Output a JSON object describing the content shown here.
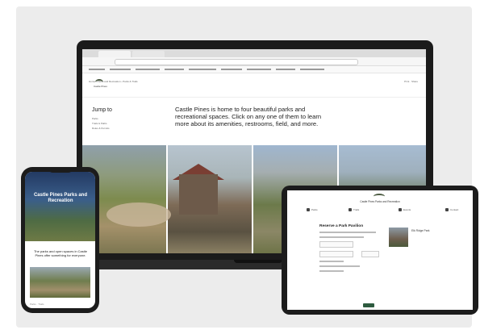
{
  "laptop": {
    "site_logo_text": "Castle Pines",
    "breadcrumb": "Home  ›  Parks and Recreation  ›  Parks & Trails",
    "share_text": "Print  ·  Share",
    "jump_to": "Jump to",
    "jump_links": [
      "Parks",
      "Trails & Paths",
      "Rules & Permits"
    ],
    "intro_text": "Castle Pines is home to four beautiful parks and recreational spaces. Click on any one of them to learn more about its amenities, restrooms, field, and more."
  },
  "phone": {
    "hero_title": "Castle Pines Parks and Recreation",
    "body_text": "The parks and open spaces in Castle Pines offer something for everyone.",
    "footer_text": "Parks  ·  Trails"
  },
  "tablet": {
    "site_title": "Castle Pines Parks and Recreation",
    "nav_items": [
      "Parks",
      "Trails",
      "Events",
      "Contact"
    ],
    "form_title": "Reserve a Park Pavilion",
    "thumb_caption": "Elk Ridge Park"
  },
  "colors": {
    "accent_green": "#2d5a3e",
    "device_frame": "#1c1c1c",
    "background": "#ececec"
  }
}
